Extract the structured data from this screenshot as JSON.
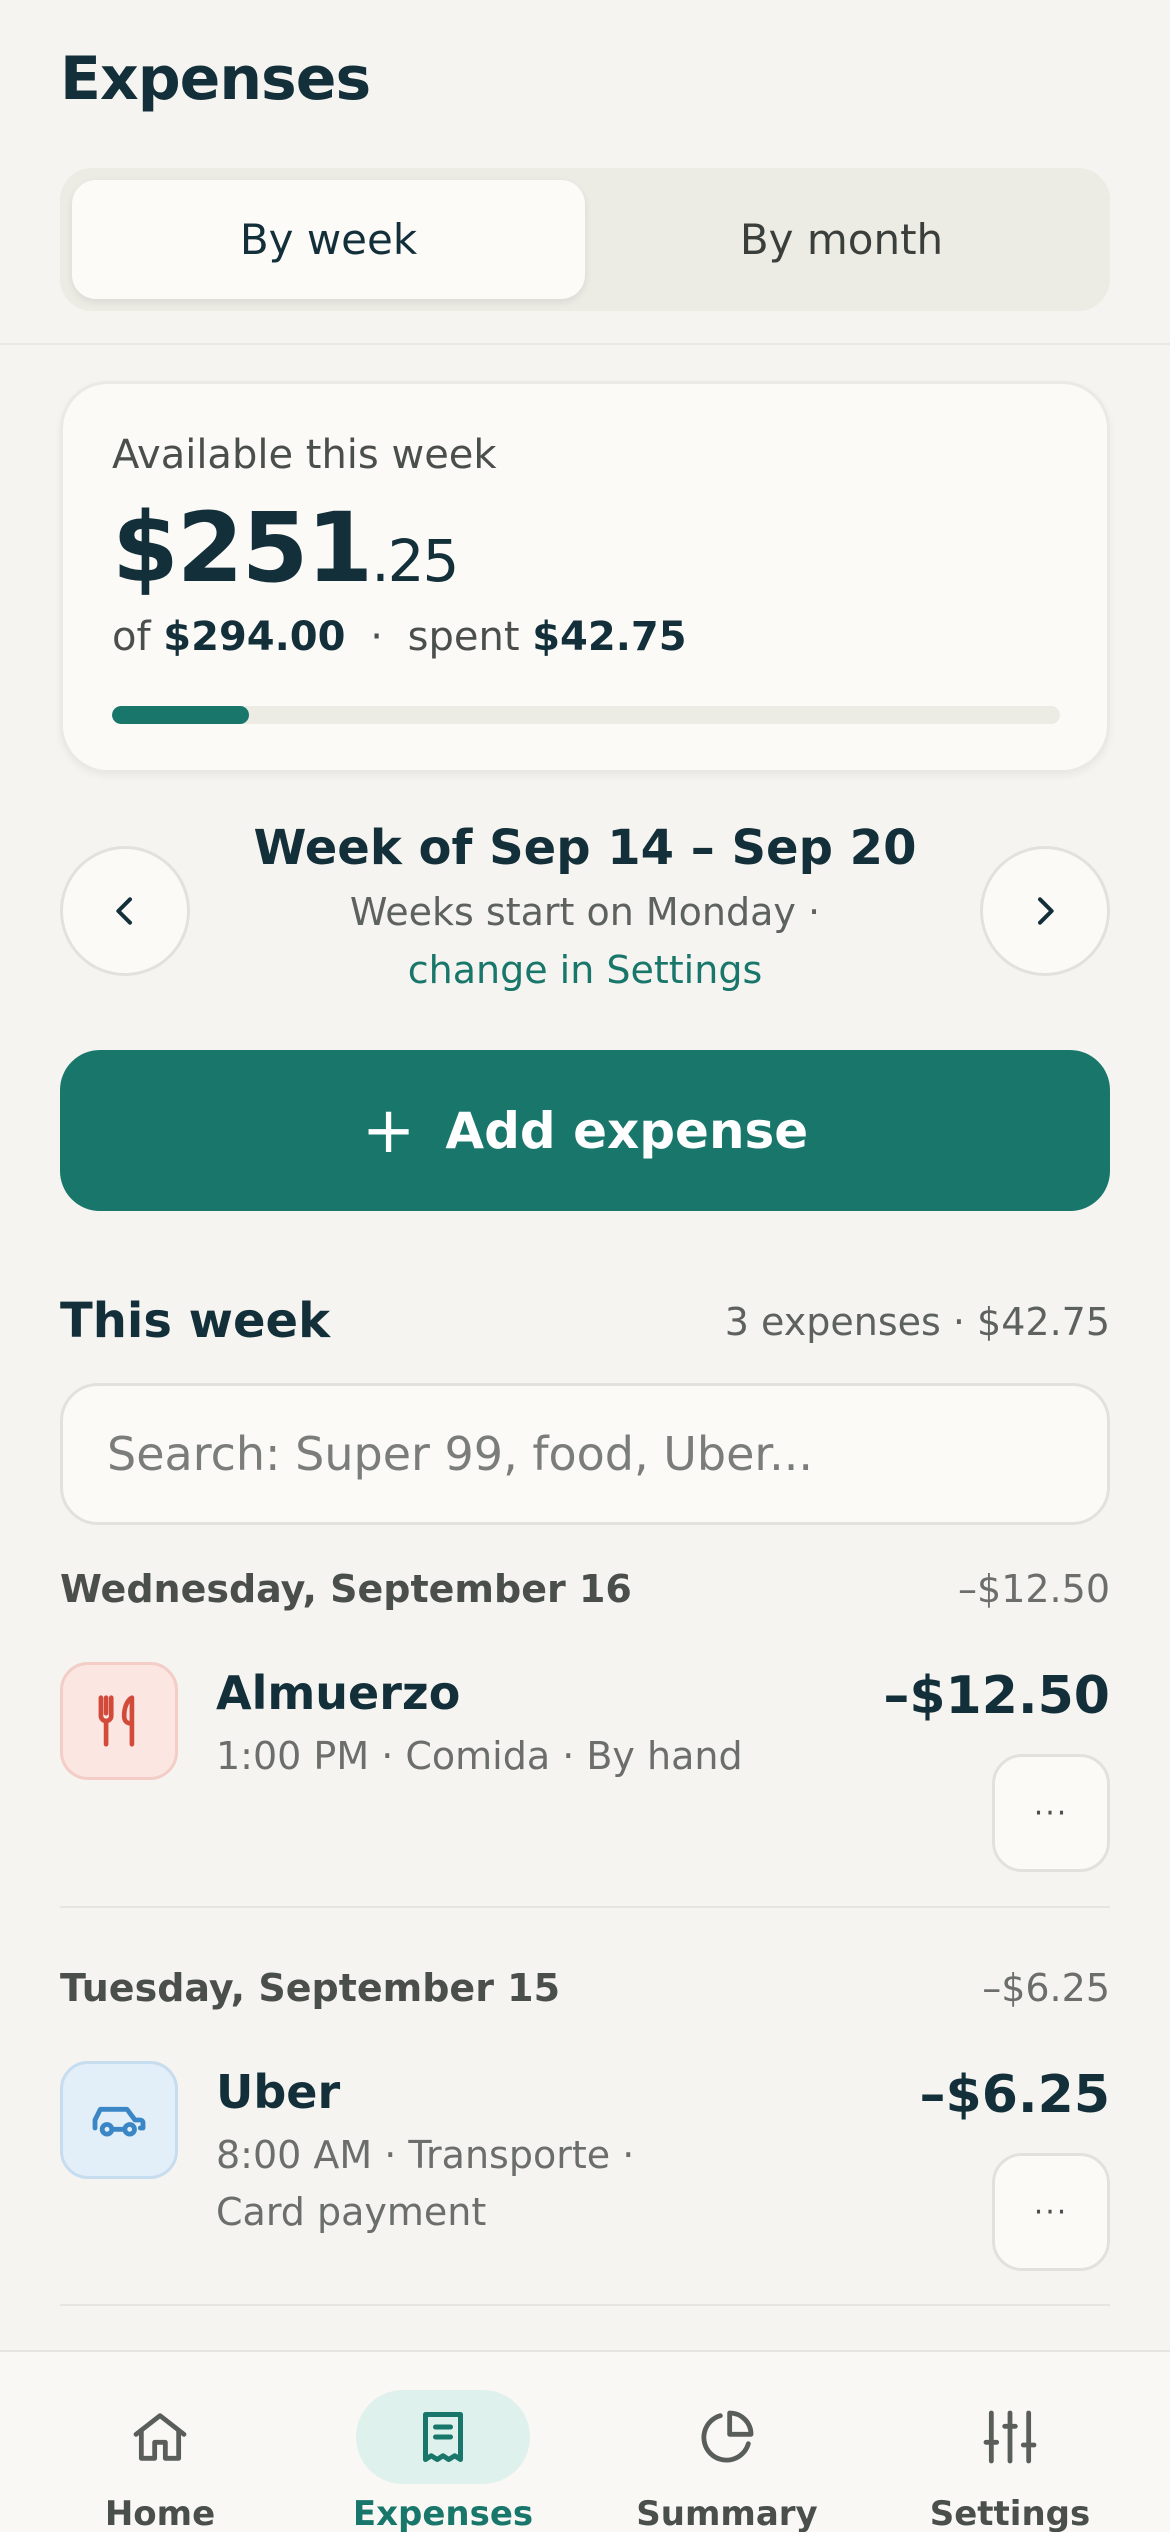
{
  "header": {
    "title": "Expenses",
    "segments": [
      "By week",
      "By month"
    ],
    "selected_segment": "By week"
  },
  "budget": {
    "label": "Available this week",
    "amount_whole": "$251",
    "amount_cents": ".25",
    "of_label": "of",
    "total": "$294.00",
    "spent_label": "spent",
    "spent": "$42.75",
    "spent_fraction": 0.145
  },
  "week_nav": {
    "title": "Week of Sep 14 – Sep 20",
    "subtitle": "Weeks start on Monday ·",
    "link": "change in Settings"
  },
  "add_button": {
    "label": "Add expense"
  },
  "list": {
    "title": "This week",
    "summary": "3 expenses · $42.75",
    "search_placeholder": "Search: Super 99, food, Uber..."
  },
  "days": [
    {
      "date": "Wednesday, September 16",
      "total": "–$12.50",
      "expenses": [
        {
          "name": "Almuerzo",
          "meta": "1:00 PM · Comida · By hand",
          "amount": "–$12.50",
          "icon": "utensils-icon",
          "icon_color": "#d24b3a"
        }
      ]
    },
    {
      "date": "Tuesday, September 15",
      "total": "–$6.25",
      "expenses": [
        {
          "name": "Uber",
          "meta": "8:00 AM · Transporte · Card payment",
          "amount": "–$6.25",
          "icon": "car-icon",
          "icon_color": "#3b86c4"
        }
      ]
    }
  ],
  "tabbar": {
    "items": [
      {
        "label": "Home",
        "icon": "home-icon"
      },
      {
        "label": "Expenses",
        "icon": "receipt-icon"
      },
      {
        "label": "Summary",
        "icon": "pie-chart-icon"
      },
      {
        "label": "Settings",
        "icon": "sliders-icon"
      }
    ],
    "active": "Expenses"
  },
  "colors": {
    "accent": "#18766b",
    "text": "#13303a",
    "background": "#f5f4f0"
  }
}
